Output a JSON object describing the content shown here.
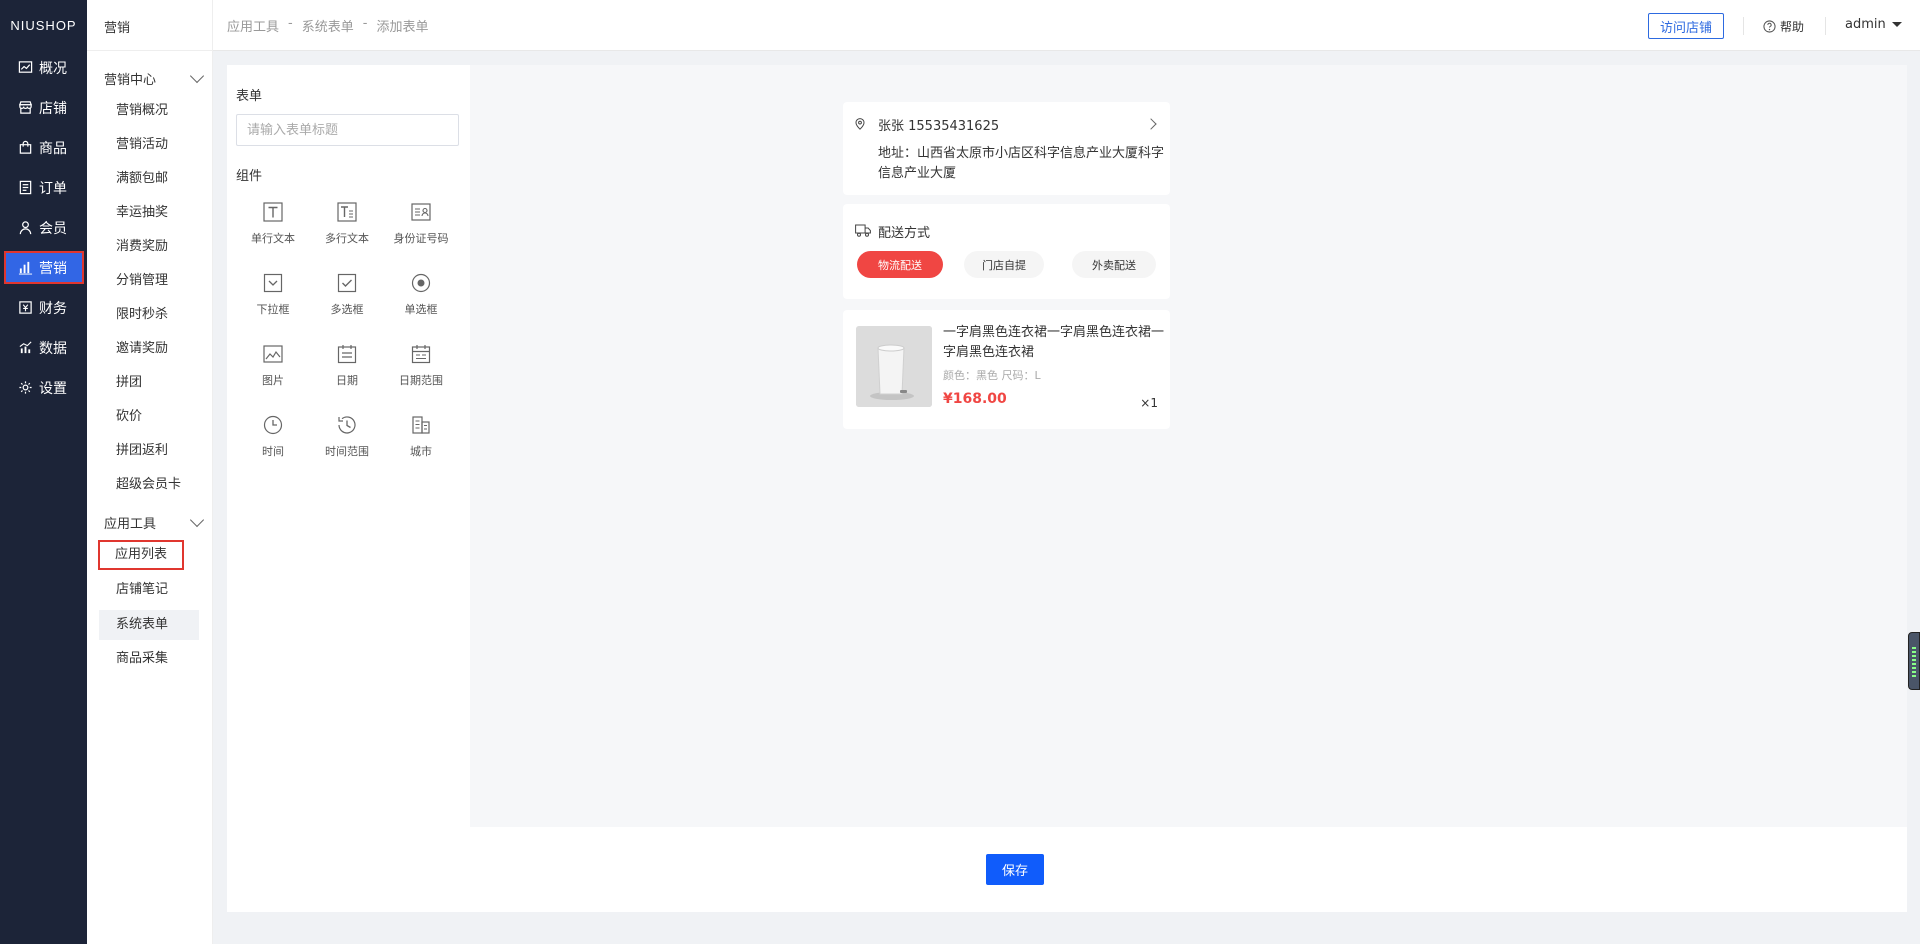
{
  "brand": "NIUSHOP",
  "nav_main": [
    {
      "label": "概况",
      "icon": "chart-icon"
    },
    {
      "label": "店铺",
      "icon": "shop-icon"
    },
    {
      "label": "商品",
      "icon": "bag-icon"
    },
    {
      "label": "订单",
      "icon": "order-icon"
    },
    {
      "label": "会员",
      "icon": "user-icon"
    },
    {
      "label": "营销",
      "icon": "bars-icon",
      "active": true
    },
    {
      "label": "财务",
      "icon": "finance-icon"
    },
    {
      "label": "数据",
      "icon": "data-icon"
    },
    {
      "label": "设置",
      "icon": "gear-icon"
    }
  ],
  "nav_sub": {
    "title": "营销",
    "group1": {
      "label": "营销中心",
      "items": [
        "营销概况",
        "营销活动",
        "满额包邮",
        "幸运抽奖",
        "消费奖励",
        "分销管理",
        "限时秒杀",
        "邀请奖励",
        "拼团",
        "砍价",
        "拼团返利",
        "超级会员卡"
      ]
    },
    "group2": {
      "label": "应用工具",
      "items": [
        "应用列表",
        "店铺笔记",
        "系统表单",
        "商品采集"
      ]
    }
  },
  "breadcrumb": [
    "应用工具",
    "-",
    "系统表单",
    "-",
    "添加表单"
  ],
  "header": {
    "visit_label": "访问店铺",
    "help_label": "帮助",
    "user": "admin"
  },
  "form_panel": {
    "title_label": "表单",
    "title_placeholder": "请输入表单标题",
    "components_label": "组件",
    "components": [
      "单行文本",
      "多行文本",
      "身份证号码",
      "下拉框",
      "多选框",
      "单选框",
      "图片",
      "日期",
      "日期范围",
      "时间",
      "时间范围",
      "城市"
    ]
  },
  "preview": {
    "name_phone": "张张 15535431625",
    "address": "地址：山西省太原市小店区科字信息产业大厦科字信息产业大厦",
    "shipping_label": "配送方式",
    "shipping_options": [
      "物流配送",
      "门店自提",
      "外卖配送"
    ],
    "product": {
      "name": "一字肩黑色连衣裙一字肩黑色连衣裙一字肩黑色连衣裙",
      "spec": "颜色：黑色   尺码：L",
      "price": "¥168.00",
      "qty": "×1"
    }
  },
  "save_label": "保存",
  "colors": {
    "sidebar": "#1c2438",
    "accent": "#3266e5",
    "primary_button": "#105cfb",
    "price": "#f04643"
  }
}
